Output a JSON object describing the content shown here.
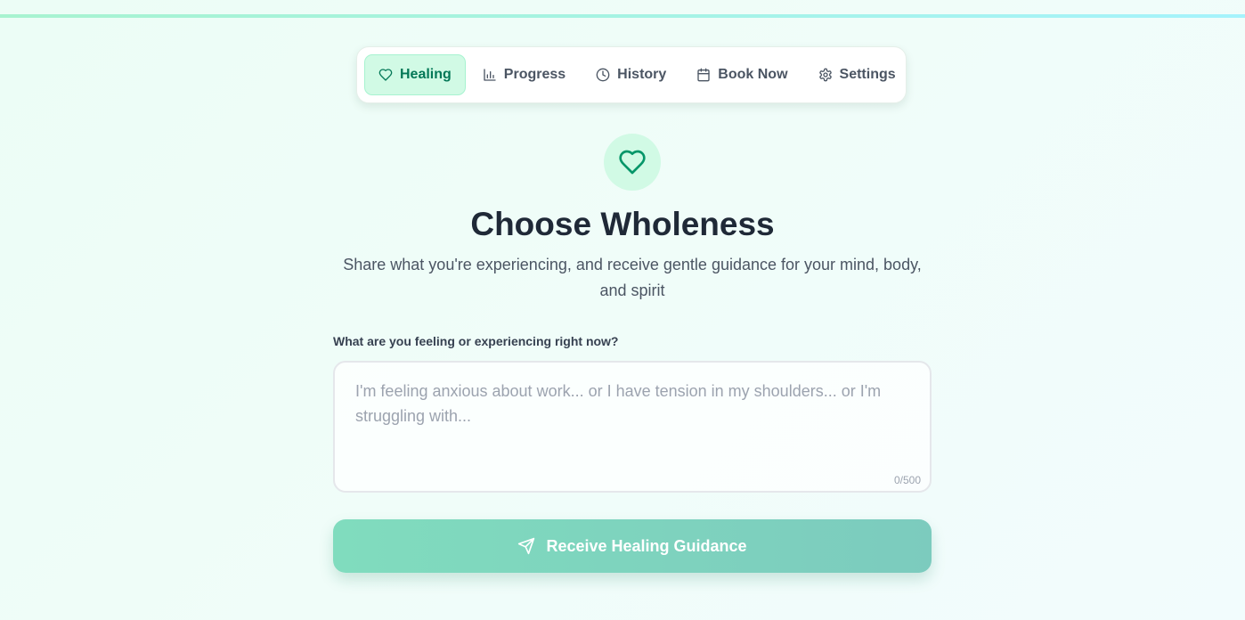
{
  "nav": {
    "items": [
      {
        "label": "Healing",
        "icon": "heart-icon",
        "active": true
      },
      {
        "label": "Progress",
        "icon": "bar-chart-icon",
        "active": false
      },
      {
        "label": "History",
        "icon": "clock-icon",
        "active": false
      },
      {
        "label": "Book Now",
        "icon": "calendar-icon",
        "active": false
      },
      {
        "label": "Settings",
        "icon": "gear-icon",
        "active": false
      }
    ]
  },
  "hero": {
    "icon": "heart-icon",
    "title": "Choose Wholeness",
    "subtitle": "Share what you're experiencing, and receive gentle guidance for your mind, body, and spirit"
  },
  "form": {
    "label": "What are you feeling or experiencing right now?",
    "value": "",
    "placeholder": "I'm feeling anxious about work... or I have tension in my shoulders... or I'm struggling with...",
    "char_count": "0/500",
    "submit_label": "Receive Healing Guidance",
    "submit_icon": "send-icon"
  },
  "colors": {
    "accent": "#047857",
    "accent_light": "#d1fae5",
    "button_start": "#80dcbe",
    "button_end": "#7ccbbe"
  }
}
